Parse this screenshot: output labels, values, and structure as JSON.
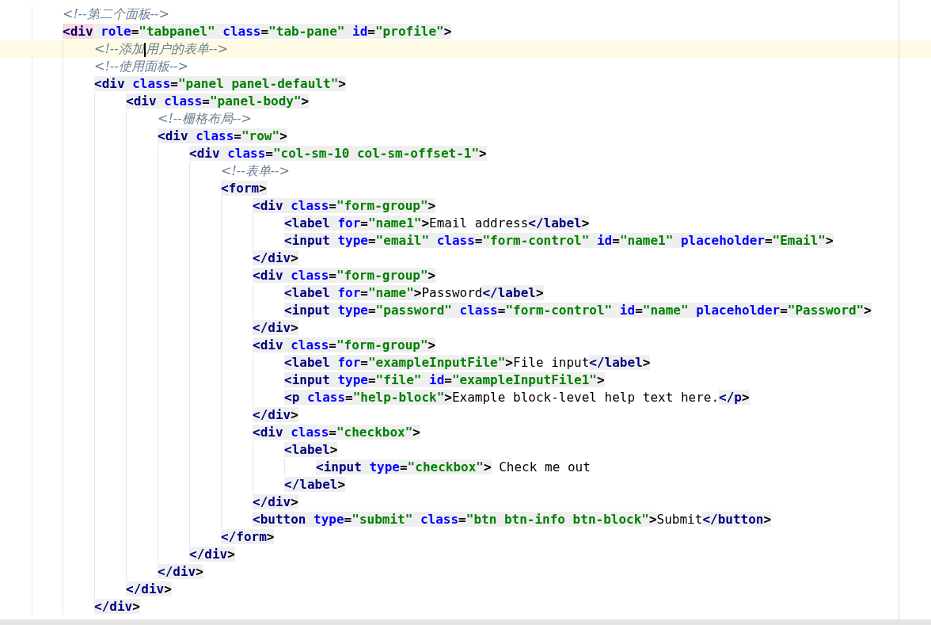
{
  "editor": {
    "lines": [
      {
        "current": false,
        "tokens": [
          {
            "kind": "comment",
            "text": "<!--第二个面板-->"
          }
        ]
      },
      {
        "current": false,
        "tokens": [
          {
            "kind": "matched",
            "text": "<div"
          },
          {
            "kind": "attr",
            "text": " role"
          },
          {
            "kind": "punct",
            "text": "="
          },
          {
            "kind": "value",
            "text": "\"tabpanel\""
          },
          {
            "kind": "attr",
            "text": " class"
          },
          {
            "kind": "punct",
            "text": "="
          },
          {
            "kind": "value",
            "text": "\"tab-pane\""
          },
          {
            "kind": "attr",
            "text": " id"
          },
          {
            "kind": "punct",
            "text": "="
          },
          {
            "kind": "value",
            "text": "\"profile\""
          },
          {
            "kind": "punct",
            "text": ">"
          }
        ],
        "children": [
          {
            "current": true,
            "tokens": [
              {
                "kind": "comment",
                "text": "<!--添加"
              },
              {
                "kind": "caret"
              },
              {
                "kind": "comment",
                "text": "用户的表单-->"
              }
            ]
          },
          {
            "current": false,
            "tokens": [
              {
                "kind": "comment",
                "text": "<!--使用面板-->"
              }
            ]
          },
          {
            "current": false,
            "tokens": [
              {
                "kind": "tag",
                "text": "<div"
              },
              {
                "kind": "attr",
                "text": " class"
              },
              {
                "kind": "punct",
                "text": "="
              },
              {
                "kind": "value",
                "text": "\"panel panel-default\""
              },
              {
                "kind": "punct",
                "text": ">"
              }
            ],
            "children": [
              {
                "current": false,
                "tokens": [
                  {
                    "kind": "tag",
                    "text": "<div"
                  },
                  {
                    "kind": "attr",
                    "text": " class"
                  },
                  {
                    "kind": "punct",
                    "text": "="
                  },
                  {
                    "kind": "value",
                    "text": "\"panel-body\""
                  },
                  {
                    "kind": "punct",
                    "text": ">"
                  }
                ],
                "children": [
                  {
                    "current": false,
                    "tokens": [
                      {
                        "kind": "comment",
                        "text": "<!--栅格布局-->"
                      }
                    ]
                  },
                  {
                    "current": false,
                    "tokens": [
                      {
                        "kind": "tag",
                        "text": "<div"
                      },
                      {
                        "kind": "attr",
                        "text": " class"
                      },
                      {
                        "kind": "punct",
                        "text": "="
                      },
                      {
                        "kind": "value",
                        "text": "\"row\""
                      },
                      {
                        "kind": "punct",
                        "text": ">"
                      }
                    ],
                    "children": [
                      {
                        "current": false,
                        "tokens": [
                          {
                            "kind": "tag",
                            "text": "<div"
                          },
                          {
                            "kind": "attr",
                            "text": " class"
                          },
                          {
                            "kind": "punct",
                            "text": "="
                          },
                          {
                            "kind": "value",
                            "text": "\"col-sm-10 col-sm-offset-1\""
                          },
                          {
                            "kind": "punct",
                            "text": ">"
                          }
                        ],
                        "children": [
                          {
                            "current": false,
                            "tokens": [
                              {
                                "kind": "comment",
                                "text": "<!--表单-->"
                              }
                            ]
                          },
                          {
                            "current": false,
                            "tokens": [
                              {
                                "kind": "tag",
                                "text": "<form"
                              },
                              {
                                "kind": "punct",
                                "text": ">"
                              }
                            ],
                            "children": [
                              {
                                "current": false,
                                "tokens": [
                                  {
                                    "kind": "tag",
                                    "text": "<div"
                                  },
                                  {
                                    "kind": "attr",
                                    "text": " class"
                                  },
                                  {
                                    "kind": "punct",
                                    "text": "="
                                  },
                                  {
                                    "kind": "value",
                                    "text": "\"form-group\""
                                  },
                                  {
                                    "kind": "punct",
                                    "text": ">"
                                  }
                                ],
                                "children": [
                                  {
                                    "current": false,
                                    "tokens": [
                                      {
                                        "kind": "tag",
                                        "text": "<label"
                                      },
                                      {
                                        "kind": "attr",
                                        "text": " for"
                                      },
                                      {
                                        "kind": "punct",
                                        "text": "="
                                      },
                                      {
                                        "kind": "value",
                                        "text": "\"name1\""
                                      },
                                      {
                                        "kind": "punct",
                                        "text": ">"
                                      },
                                      {
                                        "kind": "text",
                                        "text": "Email address"
                                      },
                                      {
                                        "kind": "tag",
                                        "text": "</label"
                                      },
                                      {
                                        "kind": "punct",
                                        "text": ">"
                                      }
                                    ]
                                  },
                                  {
                                    "current": false,
                                    "tokens": [
                                      {
                                        "kind": "tag",
                                        "text": "<input"
                                      },
                                      {
                                        "kind": "attr",
                                        "text": " type"
                                      },
                                      {
                                        "kind": "punct",
                                        "text": "="
                                      },
                                      {
                                        "kind": "value",
                                        "text": "\"email\""
                                      },
                                      {
                                        "kind": "attr",
                                        "text": " class"
                                      },
                                      {
                                        "kind": "punct",
                                        "text": "="
                                      },
                                      {
                                        "kind": "value",
                                        "text": "\"form-control\""
                                      },
                                      {
                                        "kind": "attr",
                                        "text": " id"
                                      },
                                      {
                                        "kind": "punct",
                                        "text": "="
                                      },
                                      {
                                        "kind": "value",
                                        "text": "\"name1\""
                                      },
                                      {
                                        "kind": "attr",
                                        "text": " placeholder"
                                      },
                                      {
                                        "kind": "punct",
                                        "text": "="
                                      },
                                      {
                                        "kind": "value",
                                        "text": "\"Email\""
                                      },
                                      {
                                        "kind": "punct",
                                        "text": ">"
                                      }
                                    ]
                                  }
                                ]
                              },
                              {
                                "current": false,
                                "tokens": [
                                  {
                                    "kind": "tag",
                                    "text": "</div"
                                  },
                                  {
                                    "kind": "punct",
                                    "text": ">"
                                  }
                                ]
                              },
                              {
                                "current": false,
                                "tokens": [
                                  {
                                    "kind": "tag",
                                    "text": "<div"
                                  },
                                  {
                                    "kind": "attr",
                                    "text": " class"
                                  },
                                  {
                                    "kind": "punct",
                                    "text": "="
                                  },
                                  {
                                    "kind": "value",
                                    "text": "\"form-group\""
                                  },
                                  {
                                    "kind": "punct",
                                    "text": ">"
                                  }
                                ],
                                "children": [
                                  {
                                    "current": false,
                                    "tokens": [
                                      {
                                        "kind": "tag",
                                        "text": "<label"
                                      },
                                      {
                                        "kind": "attr",
                                        "text": " for"
                                      },
                                      {
                                        "kind": "punct",
                                        "text": "="
                                      },
                                      {
                                        "kind": "value",
                                        "text": "\"name\""
                                      },
                                      {
                                        "kind": "punct",
                                        "text": ">"
                                      },
                                      {
                                        "kind": "text",
                                        "text": "Password"
                                      },
                                      {
                                        "kind": "tag",
                                        "text": "</label"
                                      },
                                      {
                                        "kind": "punct",
                                        "text": ">"
                                      }
                                    ]
                                  },
                                  {
                                    "current": false,
                                    "tokens": [
                                      {
                                        "kind": "tag",
                                        "text": "<input"
                                      },
                                      {
                                        "kind": "attr",
                                        "text": " type"
                                      },
                                      {
                                        "kind": "punct",
                                        "text": "="
                                      },
                                      {
                                        "kind": "value",
                                        "text": "\"password\""
                                      },
                                      {
                                        "kind": "attr",
                                        "text": " class"
                                      },
                                      {
                                        "kind": "punct",
                                        "text": "="
                                      },
                                      {
                                        "kind": "value",
                                        "text": "\"form-control\""
                                      },
                                      {
                                        "kind": "attr",
                                        "text": " id"
                                      },
                                      {
                                        "kind": "punct",
                                        "text": "="
                                      },
                                      {
                                        "kind": "value",
                                        "text": "\"name\""
                                      },
                                      {
                                        "kind": "attr",
                                        "text": " placeholder"
                                      },
                                      {
                                        "kind": "punct",
                                        "text": "="
                                      },
                                      {
                                        "kind": "value",
                                        "text": "\"Password\""
                                      },
                                      {
                                        "kind": "punct",
                                        "text": ">"
                                      }
                                    ]
                                  }
                                ]
                              },
                              {
                                "current": false,
                                "tokens": [
                                  {
                                    "kind": "tag",
                                    "text": "</div"
                                  },
                                  {
                                    "kind": "punct",
                                    "text": ">"
                                  }
                                ]
                              },
                              {
                                "current": false,
                                "tokens": [
                                  {
                                    "kind": "tag",
                                    "text": "<div"
                                  },
                                  {
                                    "kind": "attr",
                                    "text": " class"
                                  },
                                  {
                                    "kind": "punct",
                                    "text": "="
                                  },
                                  {
                                    "kind": "value",
                                    "text": "\"form-group\""
                                  },
                                  {
                                    "kind": "punct",
                                    "text": ">"
                                  }
                                ],
                                "children": [
                                  {
                                    "current": false,
                                    "tokens": [
                                      {
                                        "kind": "tag",
                                        "text": "<label"
                                      },
                                      {
                                        "kind": "attr",
                                        "text": " for"
                                      },
                                      {
                                        "kind": "punct",
                                        "text": "="
                                      },
                                      {
                                        "kind": "value",
                                        "text": "\"exampleInputFile\""
                                      },
                                      {
                                        "kind": "punct",
                                        "text": ">"
                                      },
                                      {
                                        "kind": "text",
                                        "text": "File input"
                                      },
                                      {
                                        "kind": "tag",
                                        "text": "</label"
                                      },
                                      {
                                        "kind": "punct",
                                        "text": ">"
                                      }
                                    ]
                                  },
                                  {
                                    "current": false,
                                    "tokens": [
                                      {
                                        "kind": "tag",
                                        "text": "<input"
                                      },
                                      {
                                        "kind": "attr",
                                        "text": " type"
                                      },
                                      {
                                        "kind": "punct",
                                        "text": "="
                                      },
                                      {
                                        "kind": "value",
                                        "text": "\"file\""
                                      },
                                      {
                                        "kind": "attr",
                                        "text": " id"
                                      },
                                      {
                                        "kind": "punct",
                                        "text": "="
                                      },
                                      {
                                        "kind": "value",
                                        "text": "\"exampleInputFile1\""
                                      },
                                      {
                                        "kind": "punct",
                                        "text": ">"
                                      }
                                    ]
                                  },
                                  {
                                    "current": false,
                                    "tokens": [
                                      {
                                        "kind": "tag",
                                        "text": "<p"
                                      },
                                      {
                                        "kind": "attr",
                                        "text": " class"
                                      },
                                      {
                                        "kind": "punct",
                                        "text": "="
                                      },
                                      {
                                        "kind": "value",
                                        "text": "\"help-block\""
                                      },
                                      {
                                        "kind": "punct",
                                        "text": ">"
                                      },
                                      {
                                        "kind": "text",
                                        "text": "Example block-level help text here."
                                      },
                                      {
                                        "kind": "tag",
                                        "text": "</p"
                                      },
                                      {
                                        "kind": "punct",
                                        "text": ">"
                                      }
                                    ]
                                  }
                                ]
                              },
                              {
                                "current": false,
                                "tokens": [
                                  {
                                    "kind": "tag",
                                    "text": "</div"
                                  },
                                  {
                                    "kind": "punct",
                                    "text": ">"
                                  }
                                ]
                              },
                              {
                                "current": false,
                                "tokens": [
                                  {
                                    "kind": "tag",
                                    "text": "<div"
                                  },
                                  {
                                    "kind": "attr",
                                    "text": " class"
                                  },
                                  {
                                    "kind": "punct",
                                    "text": "="
                                  },
                                  {
                                    "kind": "value",
                                    "text": "\"checkbox\""
                                  },
                                  {
                                    "kind": "punct",
                                    "text": ">"
                                  }
                                ],
                                "children": [
                                  {
                                    "current": false,
                                    "tokens": [
                                      {
                                        "kind": "tag",
                                        "text": "<label"
                                      },
                                      {
                                        "kind": "punct",
                                        "text": ">"
                                      }
                                    ],
                                    "children": [
                                      {
                                        "current": false,
                                        "tokens": [
                                          {
                                            "kind": "tag",
                                            "text": "<input"
                                          },
                                          {
                                            "kind": "attr",
                                            "text": " type"
                                          },
                                          {
                                            "kind": "punct",
                                            "text": "="
                                          },
                                          {
                                            "kind": "value",
                                            "text": "\"checkbox\""
                                          },
                                          {
                                            "kind": "punct",
                                            "text": ">"
                                          },
                                          {
                                            "kind": "text",
                                            "text": " Check me out"
                                          }
                                        ]
                                      }
                                    ]
                                  },
                                  {
                                    "current": false,
                                    "tokens": [
                                      {
                                        "kind": "tag",
                                        "text": "</label"
                                      },
                                      {
                                        "kind": "punct",
                                        "text": ">"
                                      }
                                    ]
                                  }
                                ]
                              },
                              {
                                "current": false,
                                "tokens": [
                                  {
                                    "kind": "tag",
                                    "text": "</div"
                                  },
                                  {
                                    "kind": "punct",
                                    "text": ">"
                                  }
                                ]
                              },
                              {
                                "current": false,
                                "tokens": [
                                  {
                                    "kind": "tag",
                                    "text": "<button"
                                  },
                                  {
                                    "kind": "attr",
                                    "text": " type"
                                  },
                                  {
                                    "kind": "punct",
                                    "text": "="
                                  },
                                  {
                                    "kind": "value",
                                    "text": "\"submit\""
                                  },
                                  {
                                    "kind": "attr",
                                    "text": " class"
                                  },
                                  {
                                    "kind": "punct",
                                    "text": "="
                                  },
                                  {
                                    "kind": "value",
                                    "text": "\"btn btn-info btn-block\""
                                  },
                                  {
                                    "kind": "punct",
                                    "text": ">"
                                  },
                                  {
                                    "kind": "text",
                                    "text": "Submit"
                                  },
                                  {
                                    "kind": "tag",
                                    "text": "</button"
                                  },
                                  {
                                    "kind": "punct",
                                    "text": ">"
                                  }
                                ]
                              }
                            ]
                          },
                          {
                            "current": false,
                            "tokens": [
                              {
                                "kind": "tag",
                                "text": "</form"
                              },
                              {
                                "kind": "punct",
                                "text": ">"
                              }
                            ]
                          }
                        ]
                      },
                      {
                        "current": false,
                        "tokens": [
                          {
                            "kind": "tag",
                            "text": "</div"
                          },
                          {
                            "kind": "punct",
                            "text": ">"
                          }
                        ]
                      }
                    ]
                  },
                  {
                    "current": false,
                    "tokens": [
                      {
                        "kind": "tag",
                        "text": "</div"
                      },
                      {
                        "kind": "punct",
                        "text": ">"
                      }
                    ]
                  }
                ]
              },
              {
                "current": false,
                "tokens": [
                  {
                    "kind": "tag",
                    "text": "</div"
                  },
                  {
                    "kind": "punct",
                    "text": ">"
                  }
                ]
              }
            ]
          },
          {
            "current": false,
            "tokens": [
              {
                "kind": "tag",
                "text": "</div"
              },
              {
                "kind": "punct",
                "text": ">"
              }
            ]
          }
        ]
      }
    ]
  }
}
